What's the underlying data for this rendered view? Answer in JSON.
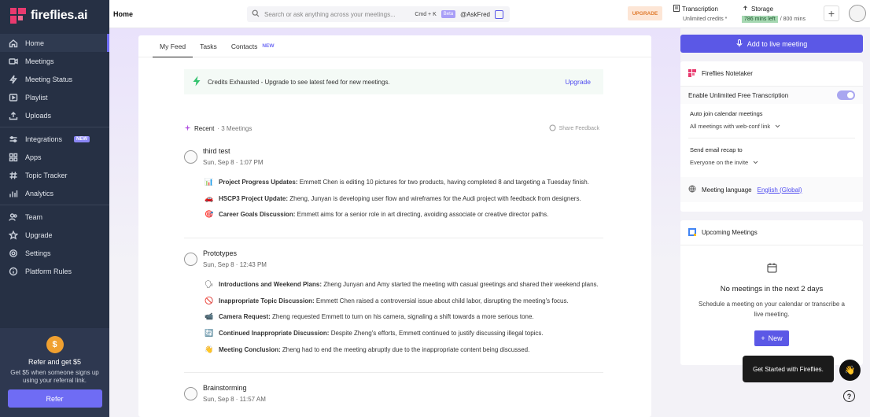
{
  "app": {
    "name": "fireflies.ai"
  },
  "sidebar": {
    "groups": [
      [
        {
          "label": "Home",
          "icon": "home-icon"
        },
        {
          "label": "Meetings",
          "icon": "video-icon"
        },
        {
          "label": "Meeting Status",
          "icon": "lightning-icon"
        },
        {
          "label": "Playlist",
          "icon": "playlist-icon"
        },
        {
          "label": "Uploads",
          "icon": "upload-icon"
        }
      ],
      [
        {
          "label": "Integrations",
          "icon": "integrations-icon",
          "badge": "NEW"
        },
        {
          "label": "Apps",
          "icon": "apps-icon"
        },
        {
          "label": "Topic Tracker",
          "icon": "topic-tracker-icon"
        },
        {
          "label": "Analytics",
          "icon": "analytics-icon"
        }
      ],
      [
        {
          "label": "Team",
          "icon": "team-icon"
        },
        {
          "label": "Upgrade",
          "icon": "star-icon"
        },
        {
          "label": "Settings",
          "icon": "gear-icon"
        },
        {
          "label": "Platform Rules",
          "icon": "info-icon"
        }
      ]
    ],
    "refer": {
      "title": "Refer and get $5",
      "description": "Get $5 when someone signs up using your referral link.",
      "button": "Refer"
    }
  },
  "topbar": {
    "page_title": "Home",
    "search_placeholder": "Search or ask anything across your meetings...",
    "shortcut": "Cmd + K",
    "beta": "Beta",
    "askfred": "@AskFred",
    "upgrade": "UPGRADE",
    "transcription_label": "Transcription",
    "transcription_value": "Unlimited credits *",
    "storage_label": "Storage",
    "storage_left": "786 mins left",
    "storage_total": "/ 800 mins"
  },
  "feed": {
    "tabs": [
      {
        "label": "My Feed"
      },
      {
        "label": "Tasks"
      },
      {
        "label": "Contacts",
        "badge": "NEW"
      }
    ],
    "credits_banner": "Credits Exhausted - Upgrade to see latest feed for new meetings.",
    "credits_upgrade": "Upgrade",
    "recent_label": "Recent",
    "recent_count": "· 3 Meetings",
    "share_feedback": "Share Feedback",
    "meetings": [
      {
        "title": "third test",
        "date": "Sun, Sep 8 · 1:07 PM",
        "points": [
          {
            "emoji": "📊",
            "heading": "Project Progress Updates:",
            "text": "Emmett Chen is editing 10 pictures for two products, having completed 8 and targeting a Tuesday finish."
          },
          {
            "emoji": "🚗",
            "heading": "HSCP3 Project Update:",
            "text": "Zheng, Junyan is developing user flow and wireframes for the Audi project with feedback from designers."
          },
          {
            "emoji": "🎯",
            "heading": "Career Goals Discussion:",
            "text": "Emmett aims for a senior role in art directing, avoiding associate or creative director paths."
          }
        ]
      },
      {
        "title": "Prototypes",
        "date": "Sun, Sep 8 · 12:43 PM",
        "points": [
          {
            "emoji": "🗣",
            "heading": "Introductions and Weekend Plans:",
            "text": "Zheng Junyan and Amy started the meeting with casual greetings and shared their weekend plans."
          },
          {
            "emoji": "🚫",
            "heading": "Inappropriate Topic Discussion:",
            "text": "Emmett Chen raised a controversial issue about child labor, disrupting the meeting's focus."
          },
          {
            "emoji": "📹",
            "heading": "Camera Request:",
            "text": "Zheng requested Emmett to turn on his camera, signaling a shift towards a more serious tone."
          },
          {
            "emoji": "🔄",
            "heading": "Continued Inappropriate Discussion:",
            "text": "Despite Zheng's efforts, Emmett continued to justify discussing illegal topics."
          },
          {
            "emoji": "👋",
            "heading": "Meeting Conclusion:",
            "text": "Zheng had to end the meeting abruptly due to the inappropriate content being discussed."
          }
        ]
      },
      {
        "title": "Brainstorming",
        "date": "Sun, Sep 8 · 11:57 AM",
        "points": []
      }
    ]
  },
  "right": {
    "live_button": "Add to live meeting",
    "notetaker": {
      "title": "Fireflies Notetaker",
      "unlimited_label": "Enable Unlimited Free Transcription",
      "auto_join_label": "Auto join calendar meetings",
      "auto_join_value": "All meetings with web-conf link",
      "recap_label": "Send email recap to",
      "recap_value": "Everyone on the invite",
      "language_label": "Meeting language",
      "language_value": "English (Global)"
    },
    "upcoming": {
      "title": "Upcoming Meetings",
      "empty_title": "No meetings in the next 2 days",
      "empty_desc": "Schedule a meeting on your calendar or transcribe a live meeting.",
      "new_button": "New"
    },
    "tooltip": "Get Started with Fireflies.",
    "help": "?"
  },
  "colors": {
    "accent": "#5b58e6",
    "sidebar": "#263044",
    "upgrade": "#e07b2e"
  }
}
